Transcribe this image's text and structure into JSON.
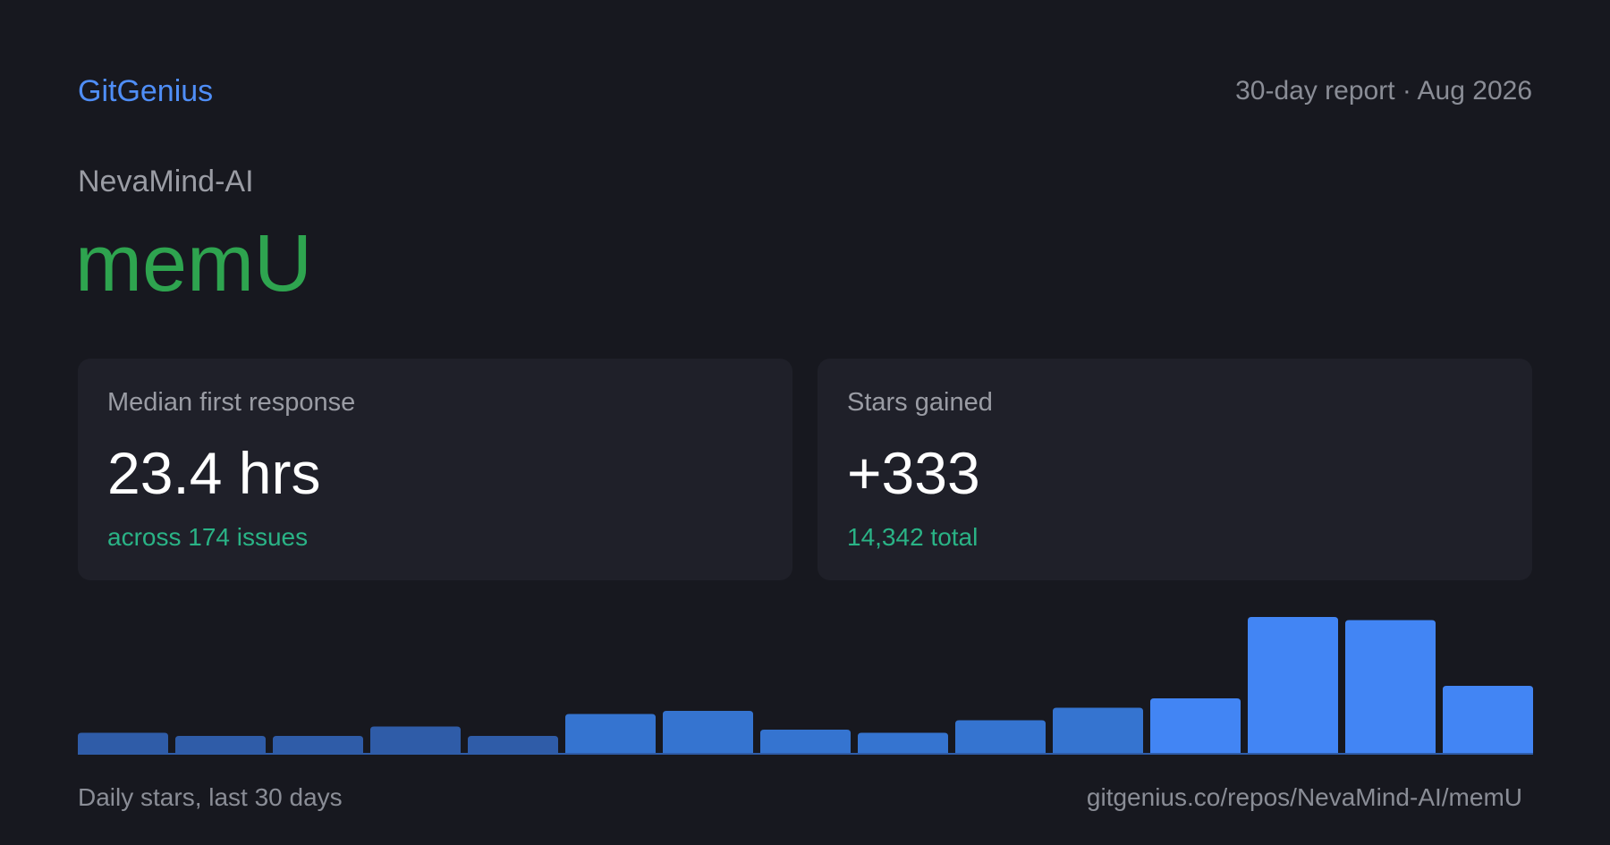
{
  "header": {
    "brand": "GitGenius",
    "report_meta": "30-day report · Aug 2026"
  },
  "repo": {
    "owner": "NevaMind-AI",
    "name": "memU"
  },
  "stats": {
    "response": {
      "label": "Median first response",
      "value": "23.4 hrs",
      "sub": "across 174 issues"
    },
    "stars": {
      "label": "Stars gained",
      "value": "+333",
      "sub": "14,342 total"
    }
  },
  "footer": {
    "caption": "Daily stars, last 30 days",
    "url": "gitgenius.co/repos/NevaMind-AI/memU"
  },
  "colors": {
    "background": "#17181f",
    "card": "#1f2029",
    "brand": "#4f8ef7",
    "repo_name": "#2ea44f",
    "sub_text": "#2ab386",
    "bar_dim": "#2f5ca8",
    "bar_mid": "#3574d0",
    "bar_bright": "#4285f4"
  },
  "chart_data": {
    "type": "bar",
    "values": [
      7,
      6,
      6,
      9,
      6,
      13,
      14,
      8,
      7,
      11,
      15,
      18,
      44,
      43,
      22
    ],
    "ylim": [
      0,
      44
    ]
  }
}
